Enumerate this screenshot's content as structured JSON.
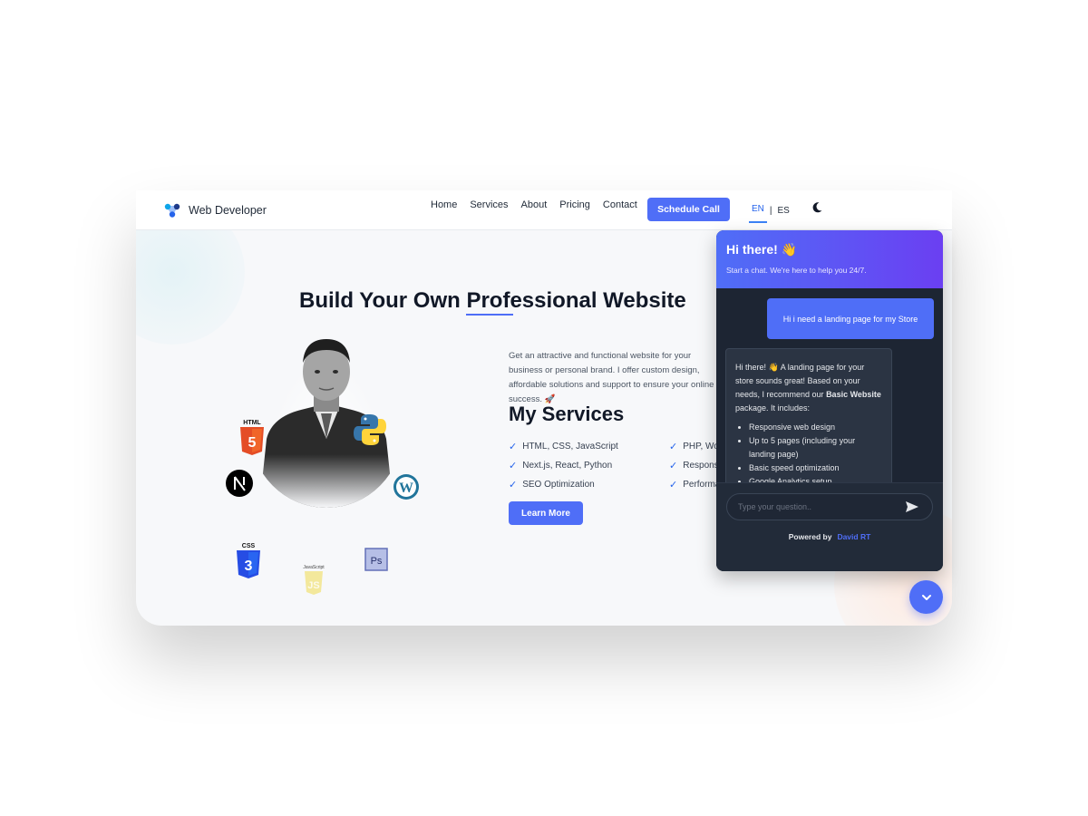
{
  "nav": {
    "brand": "Web Developer",
    "links": [
      "Home",
      "Services",
      "About",
      "Pricing",
      "Contact"
    ],
    "cta": "Schedule Call",
    "lang_en": "EN",
    "lang_sep": "|",
    "lang_es": "ES"
  },
  "hero": {
    "title_pre": "Build Your Own ",
    "title_highlight": "Professional",
    "title_post": " Website",
    "intro": "Get an attractive and functional website for your business or personal brand. I offer custom design, affordable solutions and support to ensure your online success. 🚀",
    "badges": {
      "html": "HTML",
      "css": "CSS",
      "js": "JavaScript",
      "ps": "Ps"
    }
  },
  "services": {
    "title": "My Services",
    "col1": [
      "HTML, CSS, JavaScript",
      "Next.js, React, Python",
      "SEO Optimization"
    ],
    "col2": [
      "PHP, WordPress",
      "Responsive Design",
      "Performance"
    ],
    "check": "✓",
    "button": "Learn More"
  },
  "chat": {
    "title": "Hi there! 👋",
    "subtitle": "Start a chat. We're here to help you 24/7.",
    "user_message": "Hi i need a landing page for my Store",
    "bot_intro": "Hi there! 👋 A landing page for your store sounds great! Based on your needs, I recommend our ",
    "bot_bold": "Basic Website",
    "bot_after": " package. It includes:",
    "bot_items": [
      "Responsive web design",
      "Up to 5 pages (including your landing page)",
      "Basic speed optimization",
      "Google Analytics setup"
    ],
    "input_placeholder": "Type your question..",
    "powered_label": "Powered by",
    "powered_author": "David RT"
  },
  "colors": {
    "accent": "#4f6ef7",
    "gradient_end": "#6b3ff2",
    "chat_bg": "#1f2937"
  }
}
